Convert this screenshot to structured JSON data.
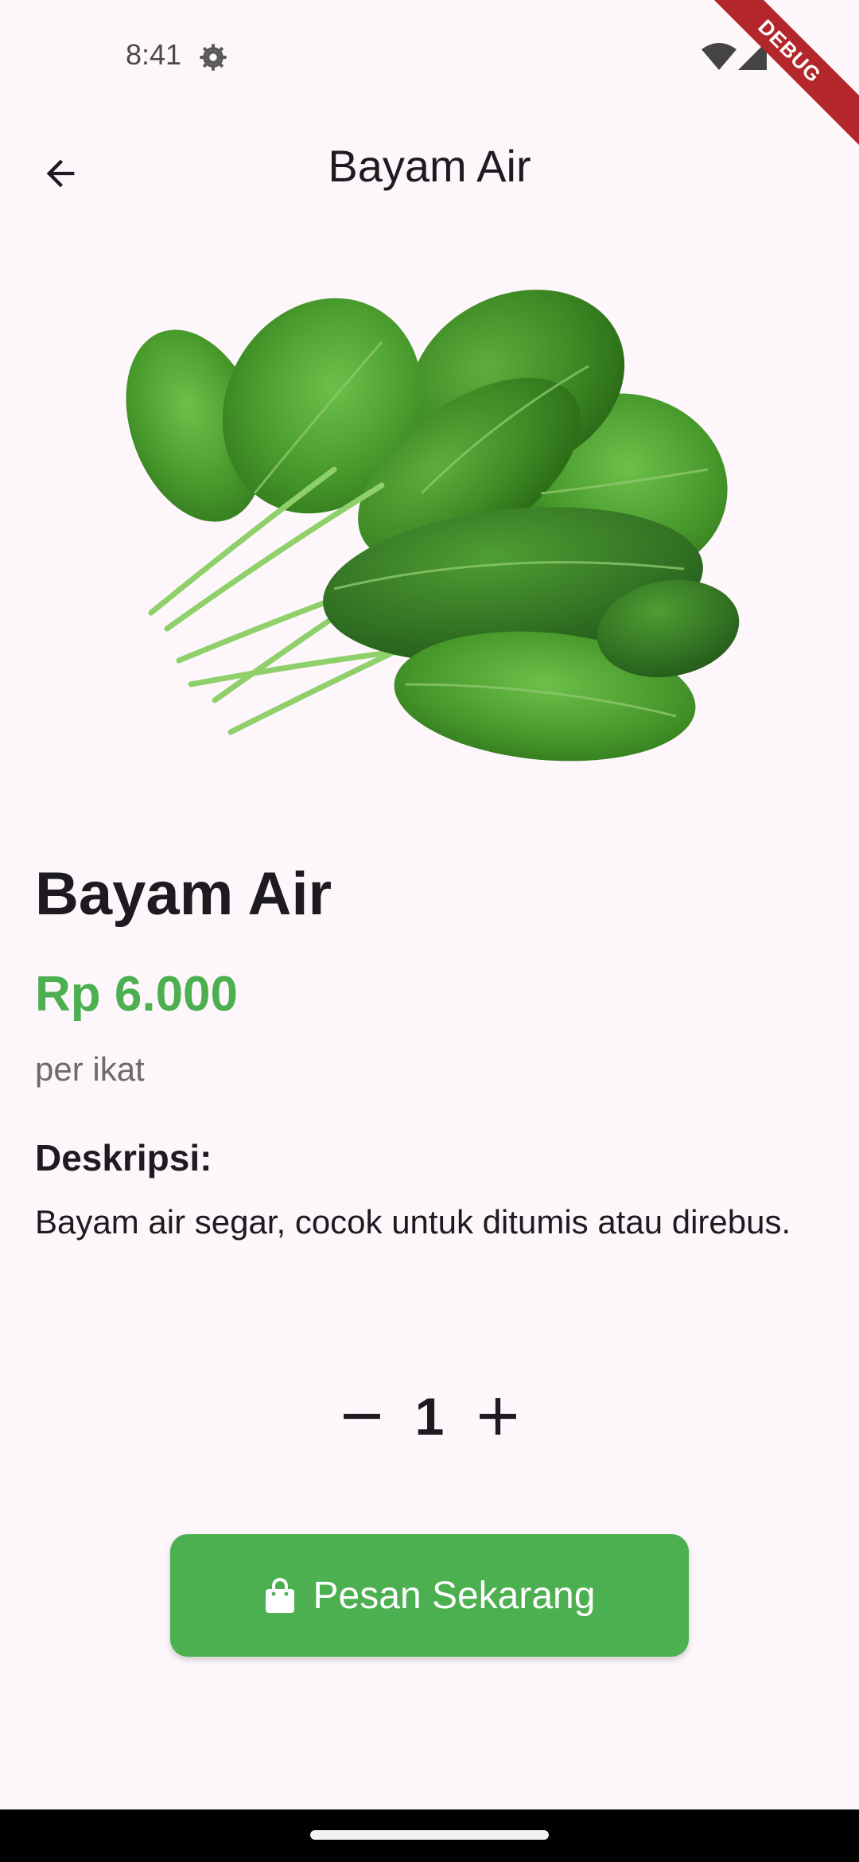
{
  "status_bar": {
    "time": "8:41",
    "icons": [
      "settings-icon",
      "wifi-icon",
      "signal-icon"
    ]
  },
  "debug_banner": "DEBUG",
  "app_bar": {
    "title": "Bayam Air",
    "back_icon": "arrow-back-icon"
  },
  "product": {
    "image": "spinach-image",
    "name": "Bayam Air",
    "price": "Rp 6.000",
    "unit": "per ikat",
    "description_label": "Deskripsi:",
    "description": "Bayam air segar, cocok untuk ditumis atau direbus."
  },
  "quantity": {
    "value": "1",
    "decrement_icon": "minus-icon",
    "increment_icon": "plus-icon"
  },
  "order_button": {
    "label": "Pesan Sekarang",
    "icon": "shopping-bag-icon"
  },
  "colors": {
    "accent": "#4caf50",
    "background": "#fdf7fb",
    "text": "#1d1b20",
    "muted": "#6b6b6b",
    "debug": "#b3262b"
  }
}
